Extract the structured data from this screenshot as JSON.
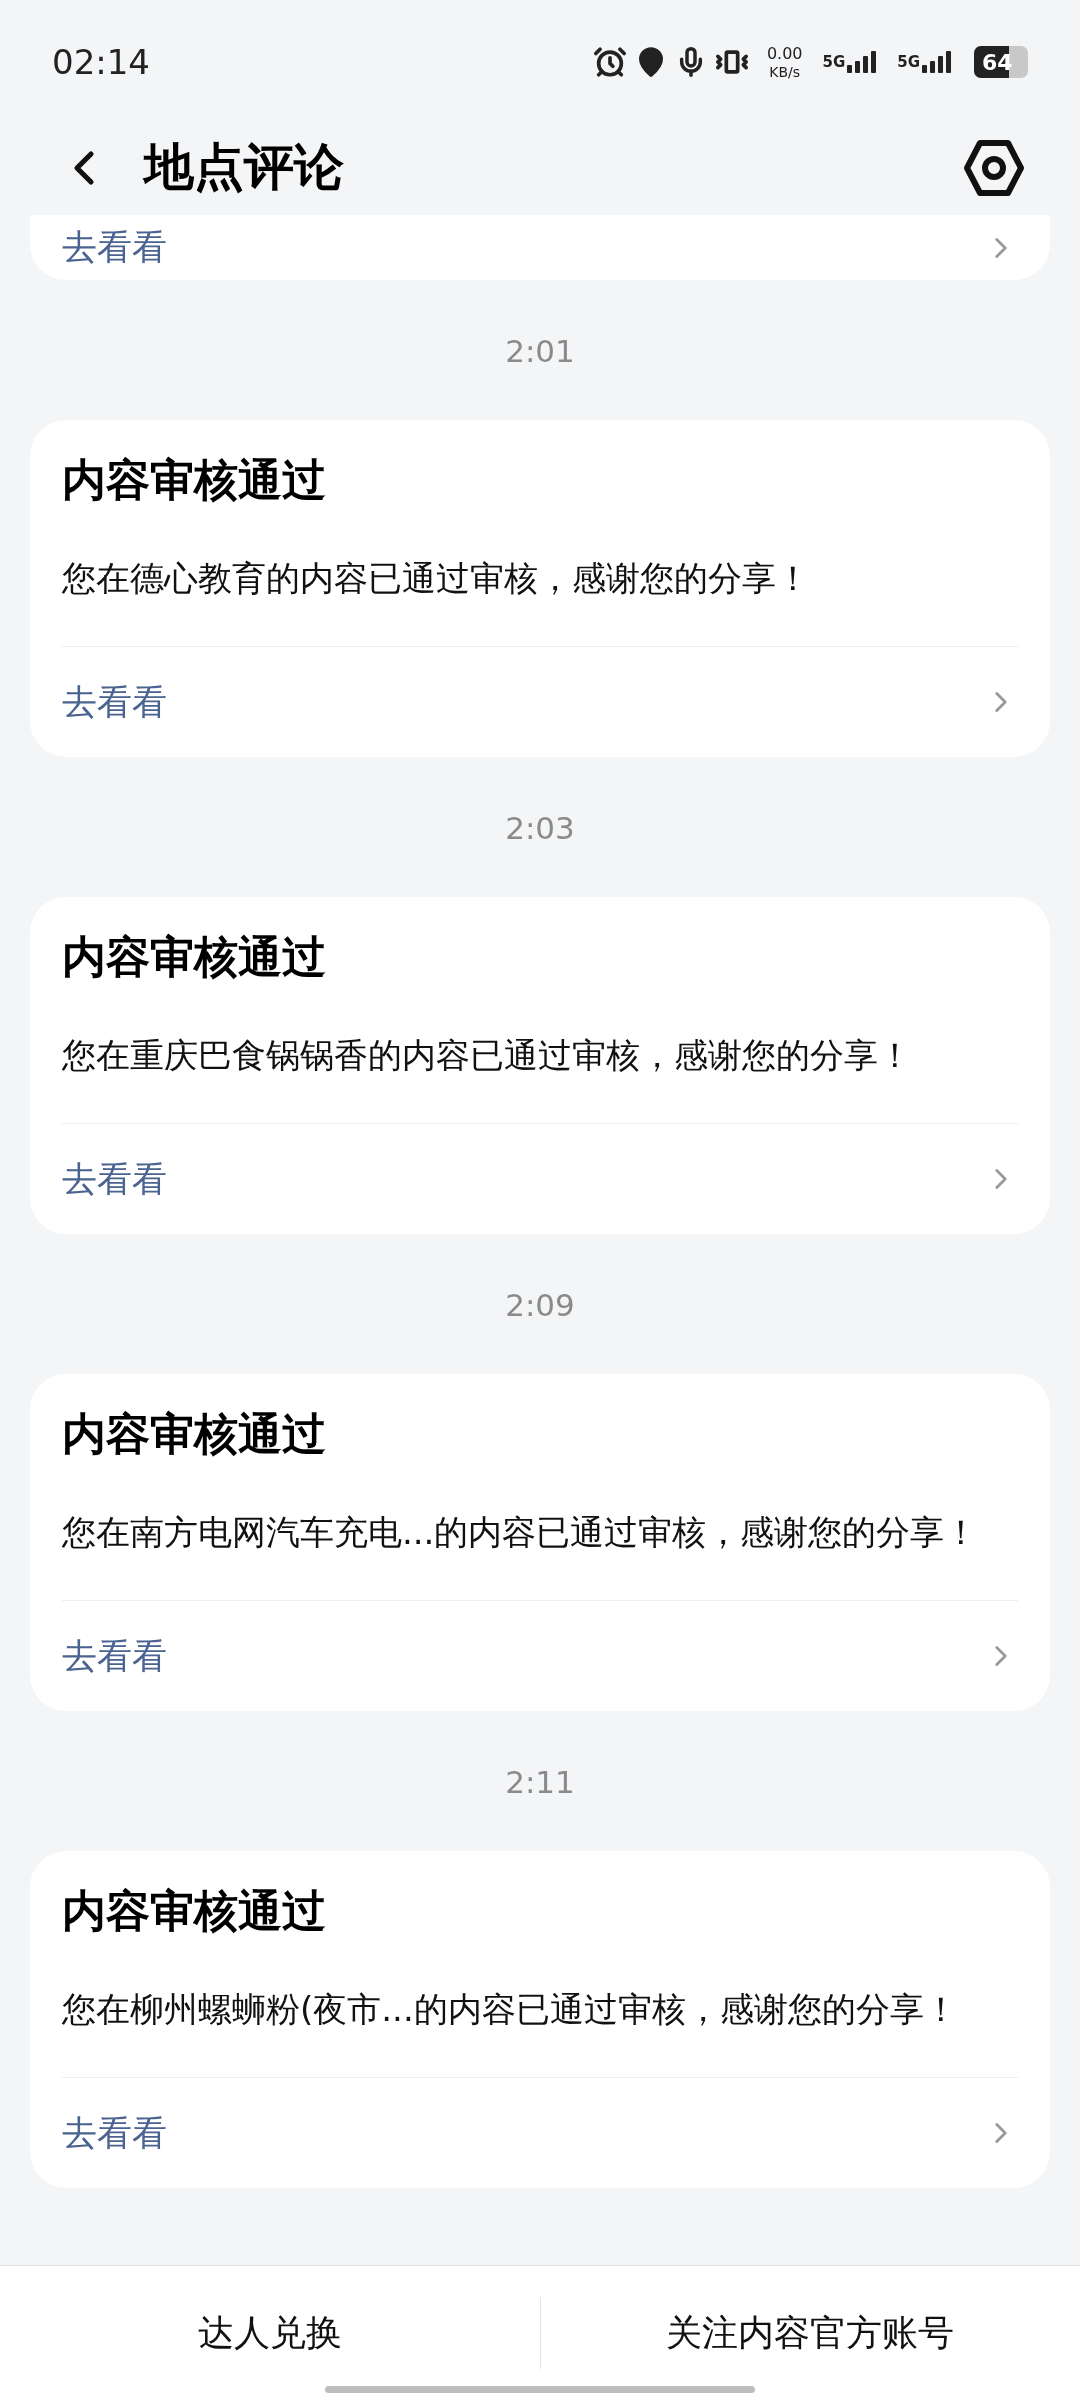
{
  "status_bar": {
    "time": "02:14",
    "net_speed": "0.00",
    "net_unit": "KB/s",
    "sims": [
      "5G",
      "5G"
    ],
    "battery": "64"
  },
  "header": {
    "title": "地点评论"
  },
  "partial_item": {
    "link": "去看看"
  },
  "messages": [
    {
      "time": "2:01",
      "title": "内容审核通过",
      "body": "您在德心教育的内容已通过审核，感谢您的分享！",
      "link": "去看看"
    },
    {
      "time": "2:03",
      "title": "内容审核通过",
      "body": "您在重庆巴食锅锅香的内容已通过审核，感谢您的分享！",
      "link": "去看看"
    },
    {
      "time": "2:09",
      "title": "内容审核通过",
      "body": "您在南方电网汽车充电...的内容已通过审核，感谢您的分享！",
      "link": "去看看"
    },
    {
      "time": "2:11",
      "title": "内容审核通过",
      "body": "您在柳州螺蛳粉(夜市...的内容已通过审核，感谢您的分享！",
      "link": "去看看"
    }
  ],
  "bottom_bar": {
    "buttons": [
      "达人兑换",
      "关注内容官方账号"
    ]
  }
}
